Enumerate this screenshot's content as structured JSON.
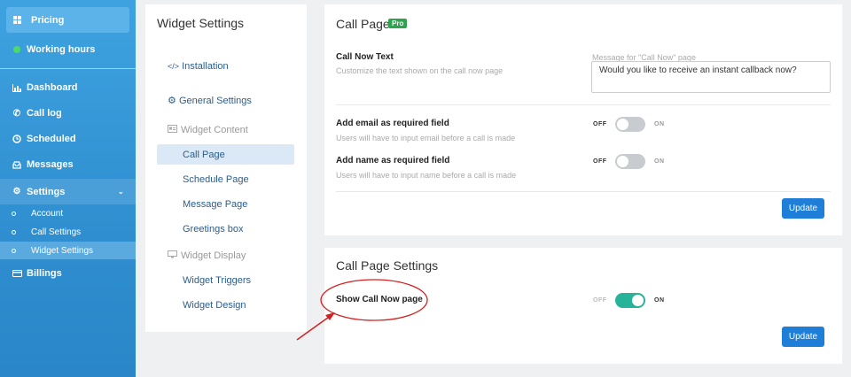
{
  "sidebar": {
    "pricing": "Pricing",
    "working_hours": "Working hours",
    "items": [
      {
        "label": "Dashboard",
        "icon": "chart-icon"
      },
      {
        "label": "Call log",
        "icon": "phone-icon"
      },
      {
        "label": "Scheduled",
        "icon": "clock-icon"
      },
      {
        "label": "Messages",
        "icon": "inbox-icon"
      },
      {
        "label": "Settings",
        "icon": "gear-icon"
      }
    ],
    "sub_items": [
      "Account",
      "Call Settings",
      "Widget Settings"
    ],
    "billings": "Billings"
  },
  "widget_settings": {
    "title": "Widget Settings",
    "installation": "Installation",
    "general_settings": "General Settings",
    "widget_content": "Widget Content",
    "content_items": [
      "Call Page",
      "Schedule Page",
      "Message Page",
      "Greetings box"
    ],
    "widget_display": "Widget Display",
    "display_items": [
      "Widget Triggers",
      "Widget Design"
    ]
  },
  "call_page": {
    "title": "Call Page",
    "badge": "Pro",
    "call_now_text_label": "Call Now Text",
    "call_now_text_hint": "Customize the text shown on the call now page",
    "message_label": "Message for \"Call Now\" page",
    "message_value": "Would you like to receive an instant callback now?",
    "email_required_label": "Add email as required field",
    "email_required_hint": "Users will have to input email before a call is made",
    "name_required_label": "Add name as required field",
    "name_required_hint": "Users will have to input name before a call is made",
    "off": "OFF",
    "on": "ON",
    "update": "Update"
  },
  "call_page_settings": {
    "title": "Call Page Settings",
    "show_call_now_label": "Show Call Now page",
    "show_call_now_on": true,
    "off": "OFF",
    "on": "ON",
    "update": "Update"
  },
  "colors": {
    "toggle_on": "#27b29a",
    "toggle_off": "#c8ccd0",
    "annotation": "#d42020"
  }
}
